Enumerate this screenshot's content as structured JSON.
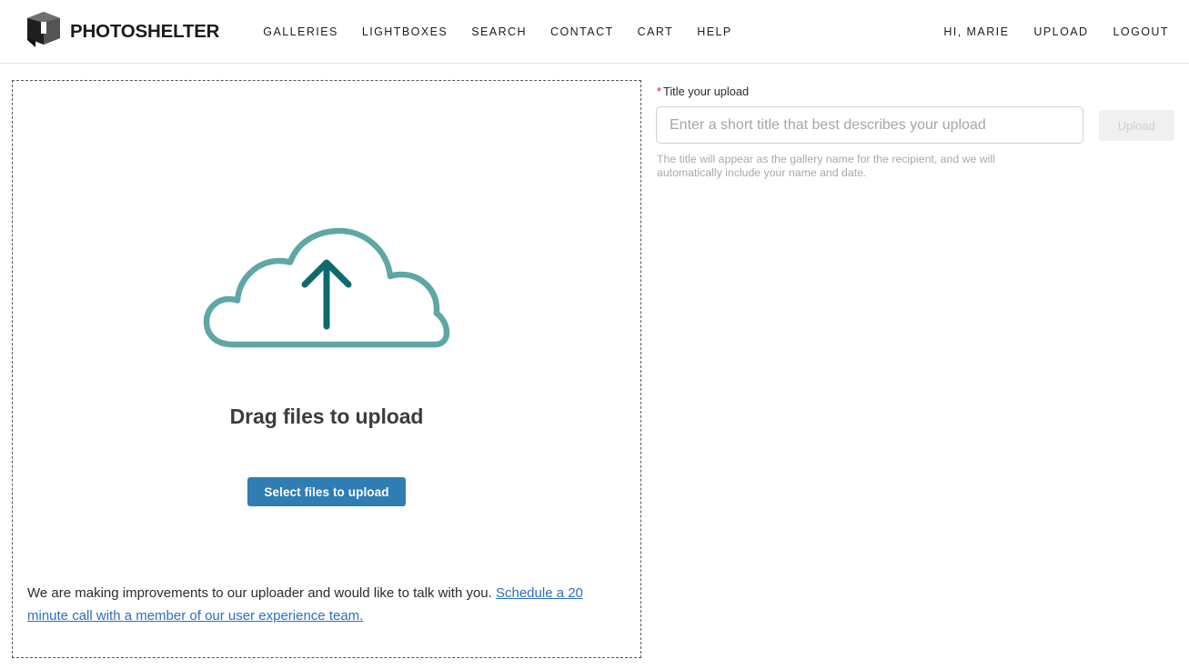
{
  "header": {
    "brand": {
      "icon": "photoshelter-cube-logo",
      "wordmark": "PHOTOSHELTER"
    },
    "nav": [
      {
        "label": "GALLERIES",
        "name": "nav-galleries"
      },
      {
        "label": "LIGHTBOXES",
        "name": "nav-lightboxes"
      },
      {
        "label": "SEARCH",
        "name": "nav-search"
      },
      {
        "label": "CONTACT",
        "name": "nav-contact"
      },
      {
        "label": "CART",
        "name": "nav-cart"
      },
      {
        "label": "HELP",
        "name": "nav-help"
      }
    ],
    "user_nav": [
      {
        "label": "HI, MARIE",
        "name": "user-greeting"
      },
      {
        "label": "UPLOAD",
        "name": "nav-upload"
      },
      {
        "label": "LOGOUT",
        "name": "nav-logout"
      }
    ]
  },
  "dropzone": {
    "icon": "cloud-upload-icon",
    "title": "Drag files to upload",
    "select_button": "Select files to upload",
    "notice": {
      "text": "We are making improvements to our uploader and would like to talk with you. ",
      "link": "Schedule a 20 minute call with a member of our user experience team."
    }
  },
  "side_panel": {
    "required_marker": "*",
    "title_label": "Title your upload",
    "title_value": "",
    "title_placeholder": "Enter a short title that best describes your upload",
    "upload_button": "Upload",
    "help_text": "The title will appear as the gallery name for the recipient, and we will automatically include your name and date."
  },
  "colors": {
    "accent_blue": "#2f7db5",
    "link_blue": "#2d6fba",
    "cloud_teal": "#5fa6a6",
    "arrow_teal": "#0e6b6b",
    "required_red": "#d9201f",
    "disabled_gray": "#f0f0f0"
  }
}
